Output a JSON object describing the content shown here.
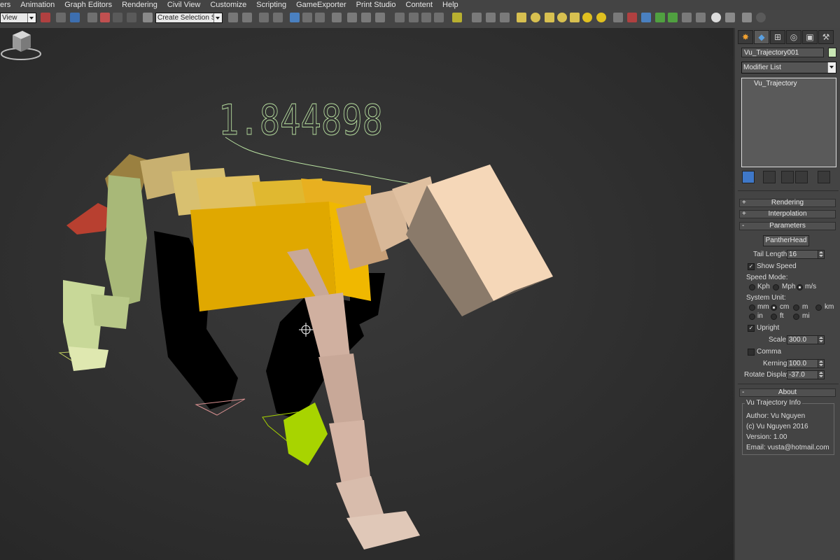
{
  "menu": [
    "ers",
    "Animation",
    "Graph Editors",
    "Rendering",
    "Civil View",
    "Customize",
    "Scripting",
    "GameExporter",
    "Print Studio",
    "Content",
    "Help"
  ],
  "toolbar": {
    "view_dropdown": "View",
    "selection_set_placeholder": "Create Selection Se"
  },
  "viewport": {
    "speed_readout": "1.844898"
  },
  "panel": {
    "tabs": [
      "create",
      "modify",
      "hierarchy",
      "motion",
      "display",
      "utilities"
    ],
    "object_name": "Vu_Trajectory001",
    "object_color": "#c8e6b4",
    "modifier_list_label": "Modifier List",
    "stack_items": [
      "Vu_Trajectory"
    ],
    "rollouts": {
      "rendering": {
        "sign": "+",
        "label": "Rendering"
      },
      "interpolation": {
        "sign": "+",
        "label": "Interpolation"
      },
      "parameters": {
        "sign": "-",
        "label": "Parameters"
      },
      "about": {
        "sign": "-",
        "label": "About"
      }
    },
    "parameters": {
      "target_button": "PantherHead",
      "tail_length_label": "Tail Length",
      "tail_length": "16",
      "show_speed_label": "Show Speed",
      "show_speed": true,
      "speed_mode_label": "Speed Mode:",
      "speed_modes": [
        "Kph",
        "Mph",
        "m/s"
      ],
      "speed_mode_selected": "m/s",
      "system_unit_label": "System Unit:",
      "system_units_row1": [
        "mm",
        "cm",
        "m",
        "km"
      ],
      "system_units_row2": [
        "in",
        "ft",
        "mi"
      ],
      "system_unit_selected": "cm",
      "upright_label": "Upright",
      "upright": true,
      "scale_label": "Scale",
      "scale": "300.0",
      "comma_label": "Comma",
      "comma": false,
      "kerning_label": "Kerning",
      "kerning": "100.0",
      "rotate_display_label": "Rotate Display",
      "rotate_display": "-37.0"
    },
    "about": {
      "group_title": "Vu Trajectory Info",
      "author": "Author: Vu Nguyen",
      "copyright": "(c) Vu Nguyen 2016",
      "version": "Version: 1.00",
      "email": "Email: vusta@hotmail.com"
    }
  },
  "colors": {
    "trajectory_line": "#b8e0a0",
    "torso_yellow": "#e0a800",
    "head_color": "#f5d7b8",
    "selected_foot": "#a8d400"
  }
}
